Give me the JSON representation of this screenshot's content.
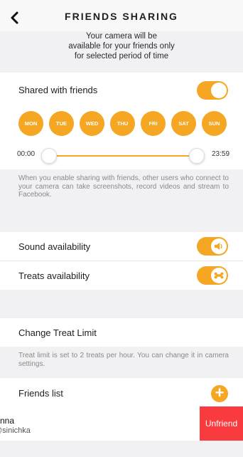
{
  "header": {
    "title": "FRIENDS SHARING",
    "back_icon": "chevron-left-icon"
  },
  "intro": {
    "line1": "Your camera will be",
    "line2": "available for your friends only",
    "line3": "for selected period of time"
  },
  "sharing": {
    "label": "Shared with friends",
    "enabled": true
  },
  "days": [
    "MON",
    "TUE",
    "WED",
    "THU",
    "FRI",
    "SAT",
    "SUN"
  ],
  "time_range": {
    "start": "00:00",
    "end": "23:59"
  },
  "sharing_note": "When you enable sharing with friends, other users who connect to your camera can take screenshots, record videos and stream to Facebook.",
  "sound": {
    "label": "Sound availability",
    "enabled": true,
    "icon": "speaker-icon"
  },
  "treats": {
    "label": "Treats availability",
    "enabled": true,
    "icon": "bone-icon"
  },
  "treat_limit": {
    "label": "Change Treat Limit",
    "note": "Treat limit is set to 2 treats per hour. You can change it in camera settings."
  },
  "friends": {
    "label": "Friends list",
    "add_icon": "plus-icon",
    "items": [
      {
        "name": "Anna",
        "username": "@sinichka",
        "action": "Unfriend"
      }
    ]
  },
  "colors": {
    "accent": "#f5a623",
    "danger": "#f93a3f",
    "background": "#f1f1f3"
  }
}
